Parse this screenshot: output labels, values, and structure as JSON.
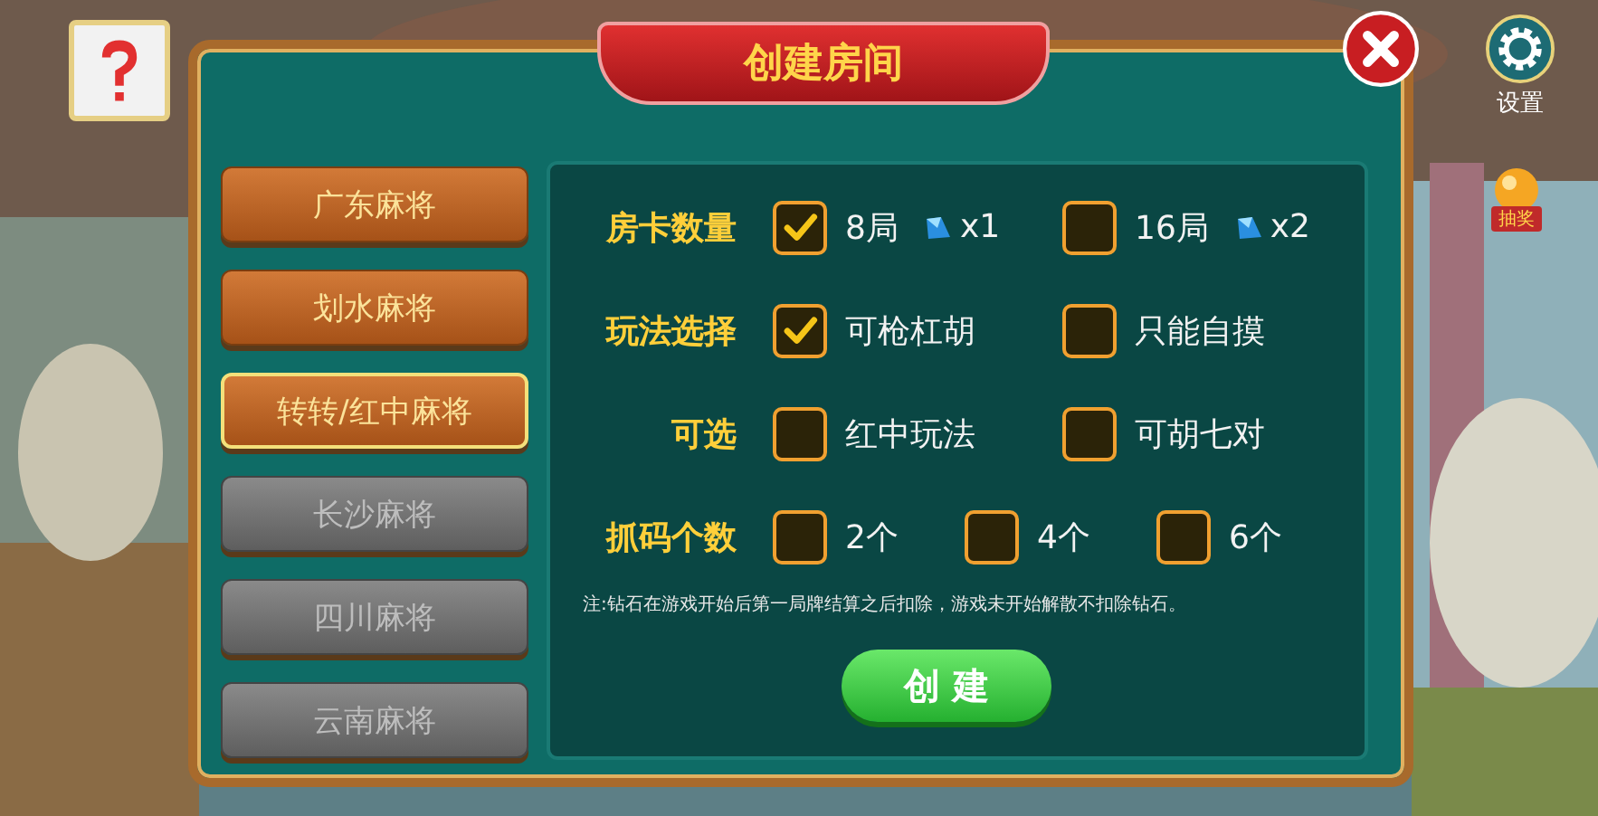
{
  "hud": {
    "settings_label": "设置",
    "lottery_label": "抽奖"
  },
  "dialog": {
    "title": "创建房间",
    "modes": [
      {
        "label": "广东麻将",
        "selected": false,
        "disabled": false
      },
      {
        "label": "划水麻将",
        "selected": false,
        "disabled": false
      },
      {
        "label": "转转/红中麻将",
        "selected": true,
        "disabled": false
      },
      {
        "label": "长沙麻将",
        "selected": false,
        "disabled": true
      },
      {
        "label": "四川麻将",
        "selected": false,
        "disabled": true
      },
      {
        "label": "云南麻将",
        "selected": false,
        "disabled": true
      }
    ],
    "rows": [
      {
        "label": "房卡数量",
        "options": [
          {
            "label": "8局",
            "checked": true,
            "cost": "x1"
          },
          {
            "label": "16局",
            "checked": false,
            "cost": "x2"
          }
        ]
      },
      {
        "label": "玩法选择",
        "options": [
          {
            "label": "可枪杠胡",
            "checked": true
          },
          {
            "label": "只能自摸",
            "checked": false
          }
        ]
      },
      {
        "label": "可选",
        "options": [
          {
            "label": "红中玩法",
            "checked": false
          },
          {
            "label": "可胡七对",
            "checked": false
          }
        ]
      },
      {
        "label": "抓码个数",
        "options": [
          {
            "label": "2个",
            "checked": false
          },
          {
            "label": "4个",
            "checked": false
          },
          {
            "label": "6个",
            "checked": false
          }
        ]
      }
    ],
    "note": "注:钻石在游戏开始后第一局牌结算之后扣除，游戏未开始解散不扣除钻石。",
    "create_button": "创 建"
  }
}
